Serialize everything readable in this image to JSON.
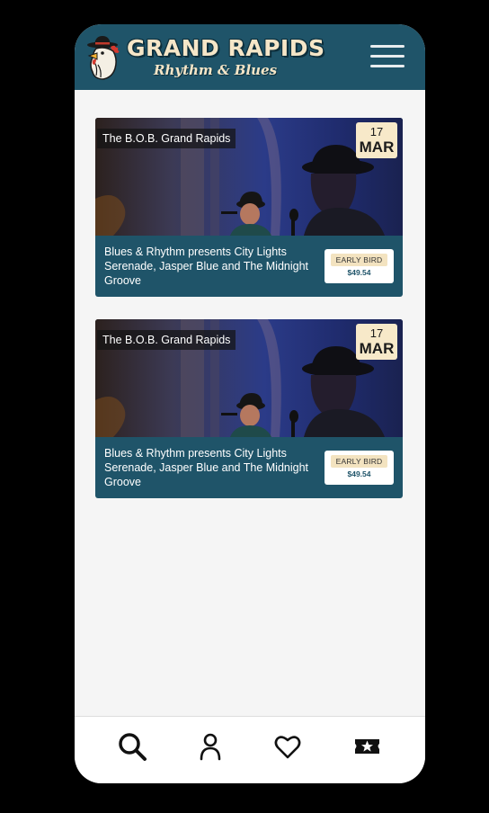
{
  "app": {
    "logo_title": "GRAND RAPIDS",
    "logo_subtitle": "Rhythm & Blues"
  },
  "header": {
    "menu_icon": "hamburger-menu-icon",
    "background_color": "#1f5469"
  },
  "events": [
    {
      "venue": "The B.O.B. Grand Rapids",
      "date_day": "17",
      "date_month": "MAR",
      "title": "Blues & Rhythm presents City Lights Serenade, Jasper Blue and The Midnight Groove",
      "ticket_tier": "EARLY BIRD",
      "price": "$49.54"
    },
    {
      "venue": "The B.O.B. Grand Rapids",
      "date_day": "17",
      "date_month": "MAR",
      "title": "Blues & Rhythm presents City Lights Serenade, Jasper Blue and The Midnight Groove",
      "ticket_tier": "EARLY BIRD",
      "price": "$49.54"
    }
  ],
  "bottom_nav": {
    "items": [
      {
        "icon": "search-icon"
      },
      {
        "icon": "profile-icon"
      },
      {
        "icon": "heart-icon"
      },
      {
        "icon": "ticket-icon"
      }
    ]
  },
  "colors": {
    "brand": "#1f5469",
    "accent_cream": "#f7e9c9",
    "page_background": "#f5f5f5"
  }
}
